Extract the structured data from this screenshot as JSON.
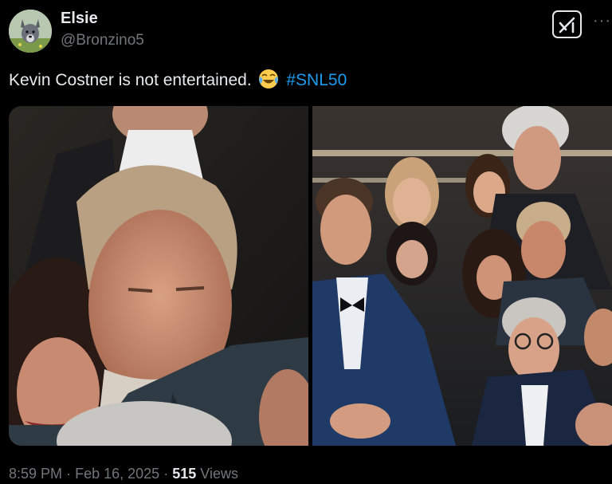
{
  "author": {
    "display_name": "Elsie",
    "handle": "@Bronzino5",
    "avatar_icon": "dog-avatar"
  },
  "header_actions": {
    "grok_icon": "grok-icon",
    "more_icon": "more-icon",
    "more_label": "···"
  },
  "tweet": {
    "text": "Kevin Costner is not entertained.",
    "emoji": "face-with-tears-of-joy",
    "hashtag": "#SNL50"
  },
  "media": {
    "photos": [
      "photo-left-closeup",
      "photo-right-audience"
    ]
  },
  "meta": {
    "time": "8:59 PM",
    "separator": "·",
    "date": "Feb 16, 2025",
    "views_count": "515",
    "views_label": "Views"
  },
  "colors": {
    "background": "#000000",
    "text_primary": "#e7e9ea",
    "text_secondary": "#71767b",
    "link": "#1d9bf0"
  }
}
